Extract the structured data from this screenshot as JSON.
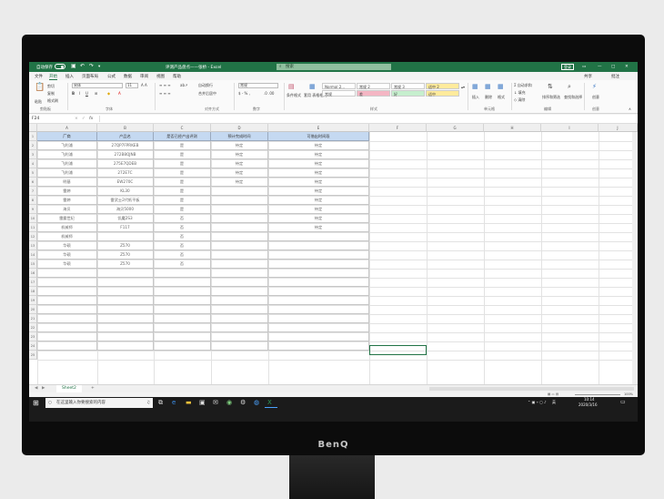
{
  "excel": {
    "autosave_label": "自动保存",
    "autosave_state": "关",
    "doc_title": "评测产品盘点——张桥 - Excel",
    "search_placeholder": "搜索",
    "signin_label": "登录",
    "share_label": "共享",
    "comments_label": "批注",
    "menu": [
      "文件",
      "开始",
      "插入",
      "页面布局",
      "公式",
      "数据",
      "审阅",
      "视图",
      "帮助"
    ],
    "ribbon": {
      "clipboard": {
        "paste": "粘贴",
        "cut": "剪切",
        "copy": "复制",
        "format_painter": "格式刷",
        "label": "剪贴板"
      },
      "font": {
        "name": "宋体",
        "size": "11",
        "label": "字体"
      },
      "alignment": {
        "wrap": "自动换行",
        "merge": "合并后居中",
        "label": "对齐方式"
      },
      "number": {
        "format": "常规",
        "label": "数字"
      },
      "styles": {
        "cond_format": "条件格式",
        "table_format": "套用 表格格式",
        "cells": [
          {
            "name": "Normal 2...",
            "fill": "#ffffff"
          },
          {
            "name": "常规 2",
            "fill": "#ffffff"
          },
          {
            "name": "常规 3",
            "fill": "#ffffff"
          },
          {
            "name": "好 2",
            "fill": "#ffffff"
          },
          {
            "name": "常规",
            "fill": "#ffffff"
          },
          {
            "name": "差",
            "fill": "#f4b6c4"
          },
          {
            "name": "好",
            "fill": "#c6efce"
          },
          {
            "name": "适中 2",
            "fill": "#ffeb9c"
          },
          {
            "name": "适中",
            "fill": "#ffeb9c"
          }
        ],
        "label": "样式"
      },
      "cells": {
        "insert": "插入",
        "delete": "删除",
        "format": "格式",
        "label": "单元格"
      },
      "editing": {
        "autosum": "自动求和",
        "fill": "填充",
        "clear": "清除",
        "sort_filter": "排序和筛选",
        "find_select": "查找和选择",
        "label": "编辑"
      },
      "ideas": {
        "btn": "创意",
        "label": "创意"
      }
    },
    "name_box": "F24",
    "formula_icons": [
      "×",
      "✓",
      "fx"
    ],
    "columns": [
      "A",
      "B",
      "C",
      "D",
      "E",
      "F",
      "G",
      "H",
      "I",
      "J"
    ],
    "table_headers": [
      "厂商",
      "产品名",
      "是否已经产出评测",
      "预计完成时间",
      "可借出时间段"
    ],
    "rows": [
      [
        "飞利浦",
        "27QP7FPRKEB",
        "是",
        "待定",
        "待定"
      ],
      [
        "飞利浦",
        "272B8QJNB",
        "是",
        "待定",
        "待定"
      ],
      [
        "飞利浦",
        "275E7QDEB",
        "是",
        "待定",
        "待定"
      ],
      [
        "飞利浦",
        "272E7C",
        "是",
        "待定",
        "待定"
      ],
      [
        "明基",
        "EW270C",
        "是",
        "待定",
        "待定"
      ],
      [
        "雷婷",
        "KL30",
        "是",
        "",
        "待定"
      ],
      [
        "雷婷",
        "雷武士2代纸平板",
        "是",
        "",
        "待定"
      ],
      [
        "海贝",
        "海贝5000",
        "是",
        "",
        "待定"
      ],
      [
        "雷霆世纪",
        "饥魔2S3",
        "否",
        "",
        "待定"
      ],
      [
        "机械师",
        "F117",
        "否",
        "",
        "待定"
      ],
      [
        "机械师",
        "",
        "否",
        "",
        ""
      ],
      [
        "华硕",
        "Z570",
        "否",
        "",
        ""
      ],
      [
        "华硕",
        "Z570",
        "否",
        "",
        ""
      ],
      [
        "华硕",
        "Z570",
        "否",
        "",
        ""
      ]
    ],
    "row_numbers": [
      "1",
      "2",
      "3",
      "4",
      "5",
      "6",
      "7",
      "8",
      "9",
      "10",
      "11",
      "12",
      "13",
      "14",
      "15",
      "16",
      "17",
      "18",
      "19",
      "20",
      "21",
      "22",
      "23",
      "24",
      "25"
    ],
    "sheet_tab": "Sheet2",
    "add_sheet": "+",
    "zoom": "100%"
  },
  "taskbar": {
    "search_placeholder": "在这里输入你要搜索的内容",
    "time": "10:14",
    "date": "2020/3/16",
    "lang": "英"
  },
  "monitor_brand": "BenQ",
  "colors": {
    "excel_green": "#217346",
    "header_fill": "#c5d9f1",
    "taskbar": "#1b1b1b"
  }
}
